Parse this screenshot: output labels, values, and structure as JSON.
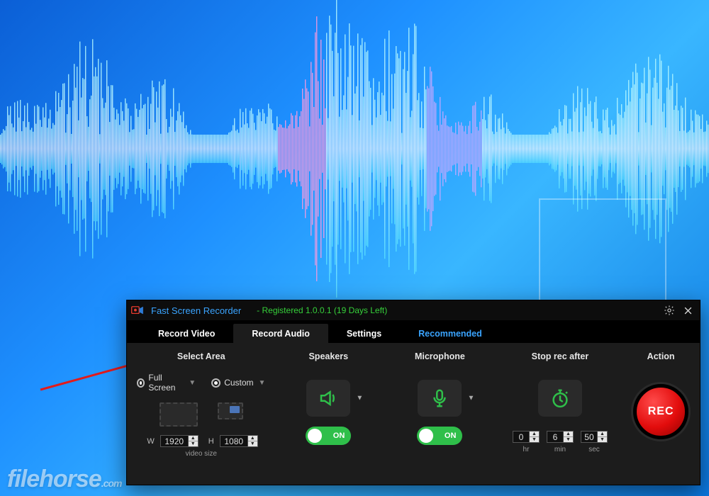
{
  "watermark": {
    "name": "filehorse",
    "suffix": ".com"
  },
  "titlebar": {
    "app_name": "Fast Screen Recorder",
    "registration": "- Registered 1.0.0.1 (19 Days Left)"
  },
  "tabs": {
    "video": "Record Video",
    "audio": "Record Audio",
    "settings": "Settings",
    "recommended": "Recommended",
    "active": "audio"
  },
  "area": {
    "heading": "Select Area",
    "full": "Full Screen",
    "custom": "Custom",
    "w_label": "W",
    "h_label": "H",
    "width": "1920",
    "height": "1080",
    "hint": "video size"
  },
  "speakers": {
    "heading": "Speakers",
    "toggle": "ON"
  },
  "microphone": {
    "heading": "Microphone",
    "toggle": "ON"
  },
  "stop": {
    "heading": "Stop rec after",
    "hr": "0",
    "min": "6",
    "sec": "50",
    "hr_lab": "hr",
    "min_lab": "min",
    "sec_lab": "sec"
  },
  "action": {
    "heading": "Action",
    "rec": "REC"
  }
}
